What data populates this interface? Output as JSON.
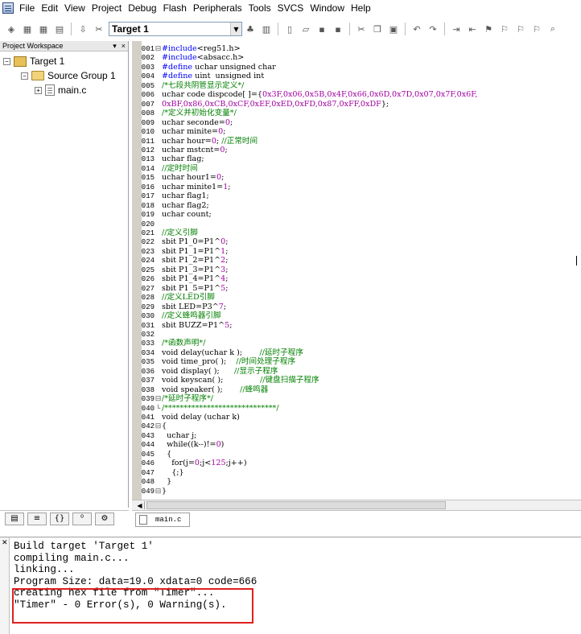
{
  "menubar": {
    "items": [
      "File",
      "Edit",
      "View",
      "Project",
      "Debug",
      "Flash",
      "Peripherals",
      "Tools",
      "SVCS",
      "Window",
      "Help"
    ]
  },
  "toolbar": {
    "target": "Target 1"
  },
  "project": {
    "header": "Project Workspace",
    "controls": [
      "▾",
      "×"
    ],
    "target": "Target 1",
    "group": "Source Group 1",
    "file": "main.c"
  },
  "editor": {
    "lines": [
      {
        "n": "001",
        "f": "⊟",
        "t": [
          [
            "kw",
            "#include"
          ],
          [
            "tx",
            "<reg51.h>"
          ]
        ]
      },
      {
        "n": "002",
        "f": "",
        "t": [
          [
            "kw",
            "#include"
          ],
          [
            "tx",
            "<absacc.h>"
          ]
        ]
      },
      {
        "n": "003",
        "f": "",
        "t": [
          [
            "kw",
            "#define"
          ],
          [
            "tx",
            " uchar unsigned char"
          ]
        ]
      },
      {
        "n": "004",
        "f": "",
        "t": [
          [
            "kw",
            "#define"
          ],
          [
            "tx",
            " uint  unsigned int"
          ]
        ]
      },
      {
        "n": "005",
        "f": "",
        "t": [
          [
            "cm",
            "/*七段共阴管显示定义*/"
          ]
        ]
      },
      {
        "n": "006",
        "f": "",
        "t": [
          [
            "tx",
            "uchar code dispcode[ ]={"
          ],
          [
            "nm",
            "0x3F,0x06,0x5B,0x4F,0x66,0x6D,0x7D,0x07,0x7F,0x6F,"
          ]
        ]
      },
      {
        "n": "007",
        "f": "",
        "t": [
          [
            "nm",
            "0xBF,0x86,0xCB,0xCF,0xEF,0xED,0xFD,0x87,0xFF,0xDF"
          ],
          [
            "tx",
            "};"
          ]
        ]
      },
      {
        "n": "008",
        "f": "",
        "t": [
          [
            "cm",
            "/*定义并初始化变量*/"
          ]
        ]
      },
      {
        "n": "009",
        "f": "",
        "t": [
          [
            "tx",
            "uchar seconde="
          ],
          [
            "nm",
            "0"
          ],
          [
            "tx",
            ";"
          ]
        ]
      },
      {
        "n": "010",
        "f": "",
        "t": [
          [
            "tx",
            "uchar minite="
          ],
          [
            "nm",
            "0"
          ],
          [
            "tx",
            ";"
          ]
        ]
      },
      {
        "n": "011",
        "f": "",
        "t": [
          [
            "tx",
            "uchar hour="
          ],
          [
            "nm",
            "0"
          ],
          [
            "tx",
            "; "
          ],
          [
            "cm",
            "//正常时间"
          ]
        ]
      },
      {
        "n": "012",
        "f": "",
        "t": [
          [
            "tx",
            "uchar mstcnt="
          ],
          [
            "nm",
            "0"
          ],
          [
            "tx",
            ";"
          ]
        ]
      },
      {
        "n": "013",
        "f": "",
        "t": [
          [
            "tx",
            "uchar flag;"
          ]
        ]
      },
      {
        "n": "014",
        "f": "",
        "t": [
          [
            "cm",
            "//定时时间"
          ]
        ]
      },
      {
        "n": "015",
        "f": "",
        "t": [
          [
            "tx",
            "uchar hour1="
          ],
          [
            "nm",
            "0"
          ],
          [
            "tx",
            ";"
          ]
        ]
      },
      {
        "n": "016",
        "f": "",
        "t": [
          [
            "tx",
            "uchar minite1="
          ],
          [
            "nm",
            "1"
          ],
          [
            "tx",
            ";"
          ]
        ]
      },
      {
        "n": "017",
        "f": "",
        "t": [
          [
            "tx",
            "uchar flag1;"
          ]
        ]
      },
      {
        "n": "018",
        "f": "",
        "t": [
          [
            "tx",
            "uchar flag2;"
          ]
        ]
      },
      {
        "n": "019",
        "f": "",
        "t": [
          [
            "tx",
            "uchar count;"
          ]
        ]
      },
      {
        "n": "020",
        "f": "",
        "t": []
      },
      {
        "n": "021",
        "f": "",
        "t": [
          [
            "cm",
            "//定义引脚"
          ]
        ]
      },
      {
        "n": "022",
        "f": "",
        "t": [
          [
            "tx",
            "sbit P1_0=P1^"
          ],
          [
            "nm",
            "0"
          ],
          [
            "tx",
            ";"
          ]
        ]
      },
      {
        "n": "023",
        "f": "",
        "t": [
          [
            "tx",
            "sbit P1_1=P1^"
          ],
          [
            "nm",
            "1"
          ],
          [
            "tx",
            ";"
          ]
        ]
      },
      {
        "n": "024",
        "f": "",
        "t": [
          [
            "tx",
            "sbit P1_2=P1^"
          ],
          [
            "nm",
            "2"
          ],
          [
            "tx",
            ";"
          ]
        ]
      },
      {
        "n": "025",
        "f": "",
        "t": [
          [
            "tx",
            "sbit P1_3=P1^"
          ],
          [
            "nm",
            "3"
          ],
          [
            "tx",
            ";"
          ]
        ]
      },
      {
        "n": "026",
        "f": "",
        "t": [
          [
            "tx",
            "sbit P1_4=P1^"
          ],
          [
            "nm",
            "4"
          ],
          [
            "tx",
            ";"
          ]
        ]
      },
      {
        "n": "027",
        "f": "",
        "t": [
          [
            "tx",
            "sbit P1_5=P1^"
          ],
          [
            "nm",
            "5"
          ],
          [
            "tx",
            ";"
          ]
        ]
      },
      {
        "n": "028",
        "f": "",
        "t": [
          [
            "cm",
            "//定义LED引脚"
          ]
        ]
      },
      {
        "n": "029",
        "f": "",
        "t": [
          [
            "tx",
            "sbit LED=P3^"
          ],
          [
            "nm",
            "7"
          ],
          [
            "tx",
            ";"
          ]
        ]
      },
      {
        "n": "030",
        "f": "",
        "t": [
          [
            "cm",
            "//定义蜂鸣器引脚"
          ]
        ]
      },
      {
        "n": "031",
        "f": "",
        "t": [
          [
            "tx",
            "sbit BUZZ=P1^"
          ],
          [
            "nm",
            "5"
          ],
          [
            "tx",
            ";"
          ]
        ]
      },
      {
        "n": "032",
        "f": "",
        "t": []
      },
      {
        "n": "033",
        "f": "",
        "t": [
          [
            "cm",
            "/*函数声明*/"
          ]
        ]
      },
      {
        "n": "034",
        "f": "",
        "t": [
          [
            "tx",
            "void delay(uchar k );       "
          ],
          [
            "cm",
            "//延时子程序"
          ]
        ]
      },
      {
        "n": "035",
        "f": "",
        "t": [
          [
            "tx",
            "void time_pro( );    "
          ],
          [
            "cm",
            "//时间处理子程序"
          ]
        ]
      },
      {
        "n": "036",
        "f": "",
        "t": [
          [
            "tx",
            "void display( );      "
          ],
          [
            "cm",
            "//显示子程序"
          ]
        ]
      },
      {
        "n": "037",
        "f": "",
        "t": [
          [
            "tx",
            "void keyscan( );               "
          ],
          [
            "cm",
            "//键盘扫描子程序"
          ]
        ]
      },
      {
        "n": "038",
        "f": "",
        "t": [
          [
            "tx",
            "void speaker( );       "
          ],
          [
            "cm",
            "//蜂鸣器"
          ]
        ]
      },
      {
        "n": "039",
        "f": "⊟",
        "t": [
          [
            "cm",
            "/*延时子程序*/"
          ]
        ]
      },
      {
        "n": "040",
        "f": "└",
        "t": [
          [
            "cm",
            "/*****************************/"
          ]
        ]
      },
      {
        "n": "041",
        "f": "",
        "t": [
          [
            "tx",
            "void delay (uchar k)"
          ]
        ]
      },
      {
        "n": "042",
        "f": "⊟",
        "t": [
          [
            "tx",
            "{"
          ]
        ]
      },
      {
        "n": "043",
        "f": "",
        "t": [
          [
            "tx",
            "  uchar j;"
          ]
        ]
      },
      {
        "n": "044",
        "f": "",
        "t": [
          [
            "tx",
            "  while((k--)!="
          ],
          [
            "nm",
            "0"
          ],
          [
            "tx",
            ")"
          ]
        ]
      },
      {
        "n": "045",
        "f": "",
        "t": [
          [
            "tx",
            "  {"
          ]
        ]
      },
      {
        "n": "046",
        "f": "",
        "t": [
          [
            "tx",
            "    for(j="
          ],
          [
            "nm",
            "0"
          ],
          [
            "tx",
            ";j<"
          ],
          [
            "nm",
            "125"
          ],
          [
            "tx",
            ";j++)"
          ]
        ]
      },
      {
        "n": "047",
        "f": "",
        "t": [
          [
            "tx",
            "    {;}"
          ]
        ]
      },
      {
        "n": "048",
        "f": "",
        "t": [
          [
            "tx",
            "  }"
          ]
        ]
      },
      {
        "n": "049",
        "f": "⊟",
        "t": [
          [
            "tx",
            "}"
          ]
        ]
      }
    ]
  },
  "file_tab": {
    "label": "main.c"
  },
  "output": {
    "lines": [
      "Build target 'Target 1'",
      "compiling main.c...",
      "linking...",
      "Program Size: data=19.0 xdata=0 code=666",
      "creating hex file from \"Timer\"...",
      "\"Timer\" - 0 Error(s), 0 Warning(s)."
    ]
  },
  "colors": {
    "keyword": "#0000ff",
    "comment": "#008000",
    "number": "#a000a0",
    "highlight": "#e02020"
  }
}
